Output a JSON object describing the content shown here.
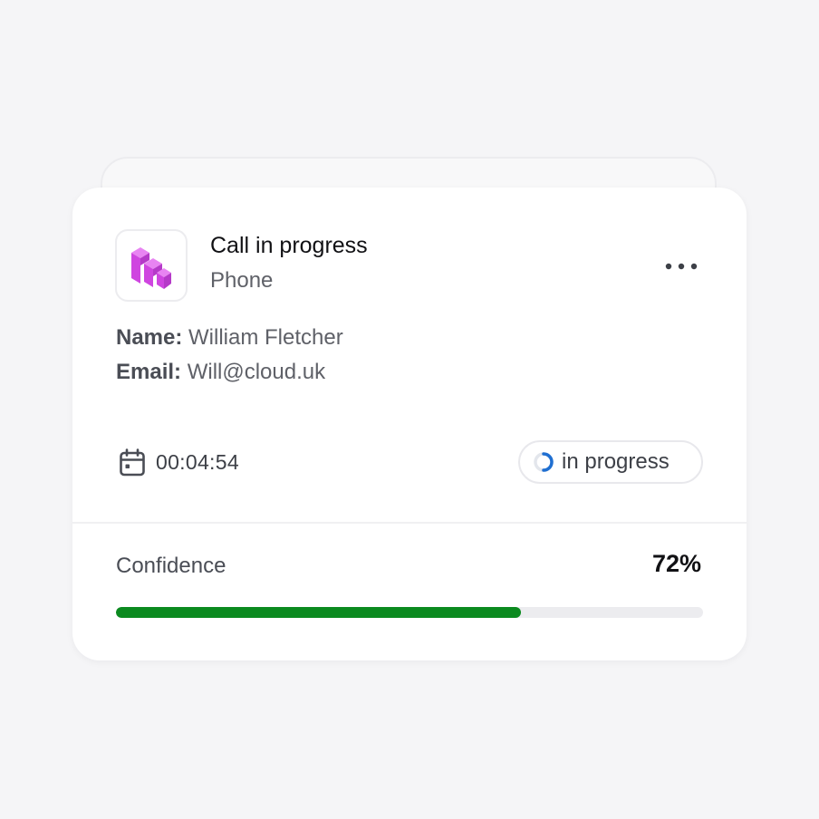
{
  "card": {
    "title": "Call in progress",
    "subtitle": "Phone",
    "app_icon": "cube-logo-icon",
    "more_icon": "more-horizontal-icon"
  },
  "contact": {
    "name_label": "Name:",
    "name_value": "William Fletcher",
    "email_label": "Email:",
    "email_value": "Will@cloud.uk"
  },
  "call": {
    "duration_icon": "calendar-icon",
    "duration": "00:04:54",
    "status_icon": "spinner-icon",
    "status": "in progress"
  },
  "confidence": {
    "label": "Confidence",
    "value_text": "72%",
    "value": 0.69
  },
  "colors": {
    "accent_logo": "#d64ee6",
    "progress_fill": "#0b8a1f",
    "spinner": "#1f6fd1"
  }
}
